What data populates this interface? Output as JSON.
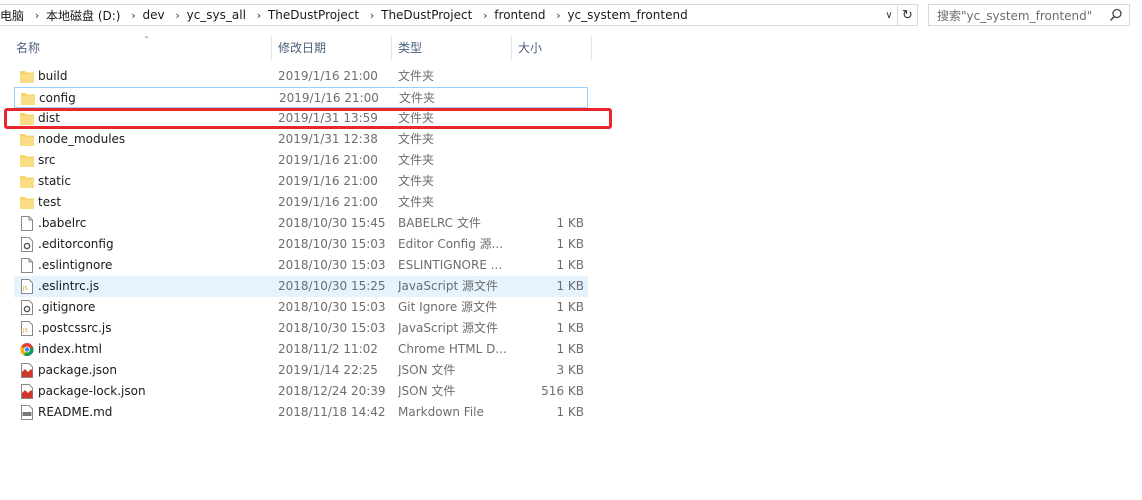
{
  "address": {
    "crumbs": [
      "电脑",
      "本地磁盘 (D:)",
      "dev",
      "yc_sys_all",
      "TheDustProject",
      "TheDustProject",
      "frontend",
      "yc_system_frontend"
    ],
    "search_placeholder": "搜索\"yc_system_frontend\""
  },
  "columns": {
    "name": "名称",
    "date": "修改日期",
    "type": "类型",
    "size": "大小"
  },
  "files": [
    {
      "name": "build",
      "date": "2019/1/16 21:00",
      "type": "文件夹",
      "size": "",
      "icon": "folder-icon"
    },
    {
      "name": "config",
      "date": "2019/1/16 21:00",
      "type": "文件夹",
      "size": "",
      "icon": "folder-icon"
    },
    {
      "name": "dist",
      "date": "2019/1/31 13:59",
      "type": "文件夹",
      "size": "",
      "icon": "folder-icon"
    },
    {
      "name": "node_modules",
      "date": "2019/1/31 12:38",
      "type": "文件夹",
      "size": "",
      "icon": "folder-icon"
    },
    {
      "name": "src",
      "date": "2019/1/16 21:00",
      "type": "文件夹",
      "size": "",
      "icon": "folder-icon"
    },
    {
      "name": "static",
      "date": "2019/1/16 21:00",
      "type": "文件夹",
      "size": "",
      "icon": "folder-icon"
    },
    {
      "name": "test",
      "date": "2019/1/16 21:00",
      "type": "文件夹",
      "size": "",
      "icon": "folder-icon"
    },
    {
      "name": ".babelrc",
      "date": "2018/10/30 15:45",
      "type": "BABELRC 文件",
      "size": "1 KB",
      "icon": "file-icon"
    },
    {
      "name": ".editorconfig",
      "date": "2018/10/30 15:03",
      "type": "Editor Config 源...",
      "size": "1 KB",
      "icon": "config-file-icon"
    },
    {
      "name": ".eslintignore",
      "date": "2018/10/30 15:03",
      "type": "ESLINTIGNORE ...",
      "size": "1 KB",
      "icon": "file-icon"
    },
    {
      "name": ".eslintrc.js",
      "date": "2018/10/30 15:25",
      "type": "JavaScript 源文件",
      "size": "1 KB",
      "icon": "js-file-icon"
    },
    {
      "name": ".gitignore",
      "date": "2018/10/30 15:03",
      "type": "Git Ignore 源文件",
      "size": "1 KB",
      "icon": "config-file-icon"
    },
    {
      "name": ".postcssrc.js",
      "date": "2018/10/30 15:03",
      "type": "JavaScript 源文件",
      "size": "1 KB",
      "icon": "js-file-icon"
    },
    {
      "name": "index.html",
      "date": "2018/11/2 11:02",
      "type": "Chrome HTML D...",
      "size": "1 KB",
      "icon": "chrome-icon"
    },
    {
      "name": "package.json",
      "date": "2019/1/14 22:25",
      "type": "JSON 文件",
      "size": "3 KB",
      "icon": "json-file-icon"
    },
    {
      "name": "package-lock.json",
      "date": "2018/12/24 20:39",
      "type": "JSON 文件",
      "size": "516 KB",
      "icon": "json-file-icon"
    },
    {
      "name": "README.md",
      "date": "2018/11/18 14:42",
      "type": "Markdown File",
      "size": "1 KB",
      "icon": "markdown-file-icon"
    }
  ],
  "states": {
    "outlined_row": 1,
    "highlighted_row": 2,
    "hover_row": 10
  },
  "colors": {
    "folder": "#f7d46a",
    "highlight": "#e8262b",
    "hover": "#e5f3ff",
    "header_text": "#4c607a"
  }
}
